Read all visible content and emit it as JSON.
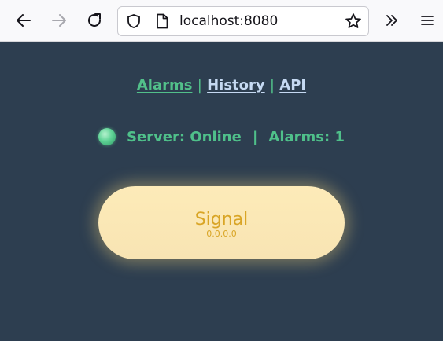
{
  "browser": {
    "url": "localhost:8080"
  },
  "nav": {
    "items": [
      {
        "label": "Alarms",
        "active": true
      },
      {
        "label": "History",
        "active": false
      },
      {
        "label": "API",
        "active": false
      }
    ],
    "separator": "|"
  },
  "status": {
    "server_text": "Server: Online",
    "divider": "|",
    "alarms_text": "Alarms: 1",
    "indicator_color": "#5fd396"
  },
  "signal_button": {
    "label": "Signal",
    "version": "0.0.0.0"
  },
  "colors": {
    "page_background": "#2d3e50",
    "accent_green": "#52c08a",
    "button_fill": "#fbe8b5",
    "button_text": "#d9a526"
  }
}
